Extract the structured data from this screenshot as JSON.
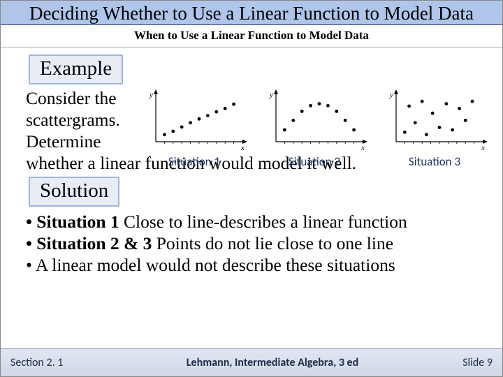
{
  "title": "Deciding Whether to Use a Linear Function to Model Data",
  "subtitle": "When to Use a Linear Function to Model Data",
  "example_label": "Example",
  "solution_label": "Solution",
  "intro": {
    "l1": "Consider the",
    "l2": "scattergrams.",
    "l3": "Determine",
    "l4": "whether a linear function would model it well."
  },
  "situations": [
    "Situation 1",
    "Situation 2",
    "Situation 3"
  ],
  "bullets": {
    "b1_bold": "• Situation 1",
    "b1_rest": " Close to line-describes a linear function",
    "b2_bold": "• Situation 2 & 3",
    "b2_rest": " Points do not lie close to one line",
    "b3": "• A linear model would not describe these situations"
  },
  "footer": {
    "left": "Section 2. 1",
    "center": "Lehmann, Intermediate Algebra, 3 ed",
    "right": "Slide 9"
  },
  "chart_data": [
    {
      "type": "scatter",
      "title": "Situation 1",
      "xlabel": "x",
      "ylabel": "y",
      "xlim": [
        0,
        10
      ],
      "ylim": [
        0,
        10
      ],
      "points": [
        [
          1,
          1.5
        ],
        [
          2,
          2.2
        ],
        [
          3,
          3.1
        ],
        [
          4,
          4.0
        ],
        [
          5,
          4.8
        ],
        [
          6,
          5.5
        ],
        [
          7,
          6.3
        ],
        [
          8,
          7.0
        ],
        [
          9,
          7.9
        ]
      ],
      "pattern": "approximately linear increasing"
    },
    {
      "type": "scatter",
      "title": "Situation 2",
      "xlabel": "x",
      "ylabel": "y",
      "xlim": [
        0,
        10
      ],
      "ylim": [
        0,
        10
      ],
      "points": [
        [
          1,
          2.5
        ],
        [
          2,
          4.5
        ],
        [
          3,
          6.4
        ],
        [
          4,
          7.6
        ],
        [
          5,
          8.0
        ],
        [
          6,
          7.6
        ],
        [
          7,
          6.4
        ],
        [
          8,
          4.5
        ],
        [
          9,
          2.5
        ]
      ],
      "pattern": "inverted-U / parabolic"
    },
    {
      "type": "scatter",
      "title": "Situation 3",
      "xlabel": "x",
      "ylabel": "y",
      "xlim": [
        0,
        10
      ],
      "ylim": [
        0,
        10
      ],
      "points": [
        [
          1,
          2
        ],
        [
          1.5,
          7.5
        ],
        [
          2.2,
          4
        ],
        [
          3,
          8.5
        ],
        [
          3.5,
          1.5
        ],
        [
          4.2,
          6
        ],
        [
          5,
          3
        ],
        [
          5.8,
          8
        ],
        [
          6.5,
          2.5
        ],
        [
          7.3,
          7
        ],
        [
          8,
          4.5
        ],
        [
          8.8,
          8.5
        ]
      ],
      "pattern": "no clear trend / random"
    }
  ]
}
